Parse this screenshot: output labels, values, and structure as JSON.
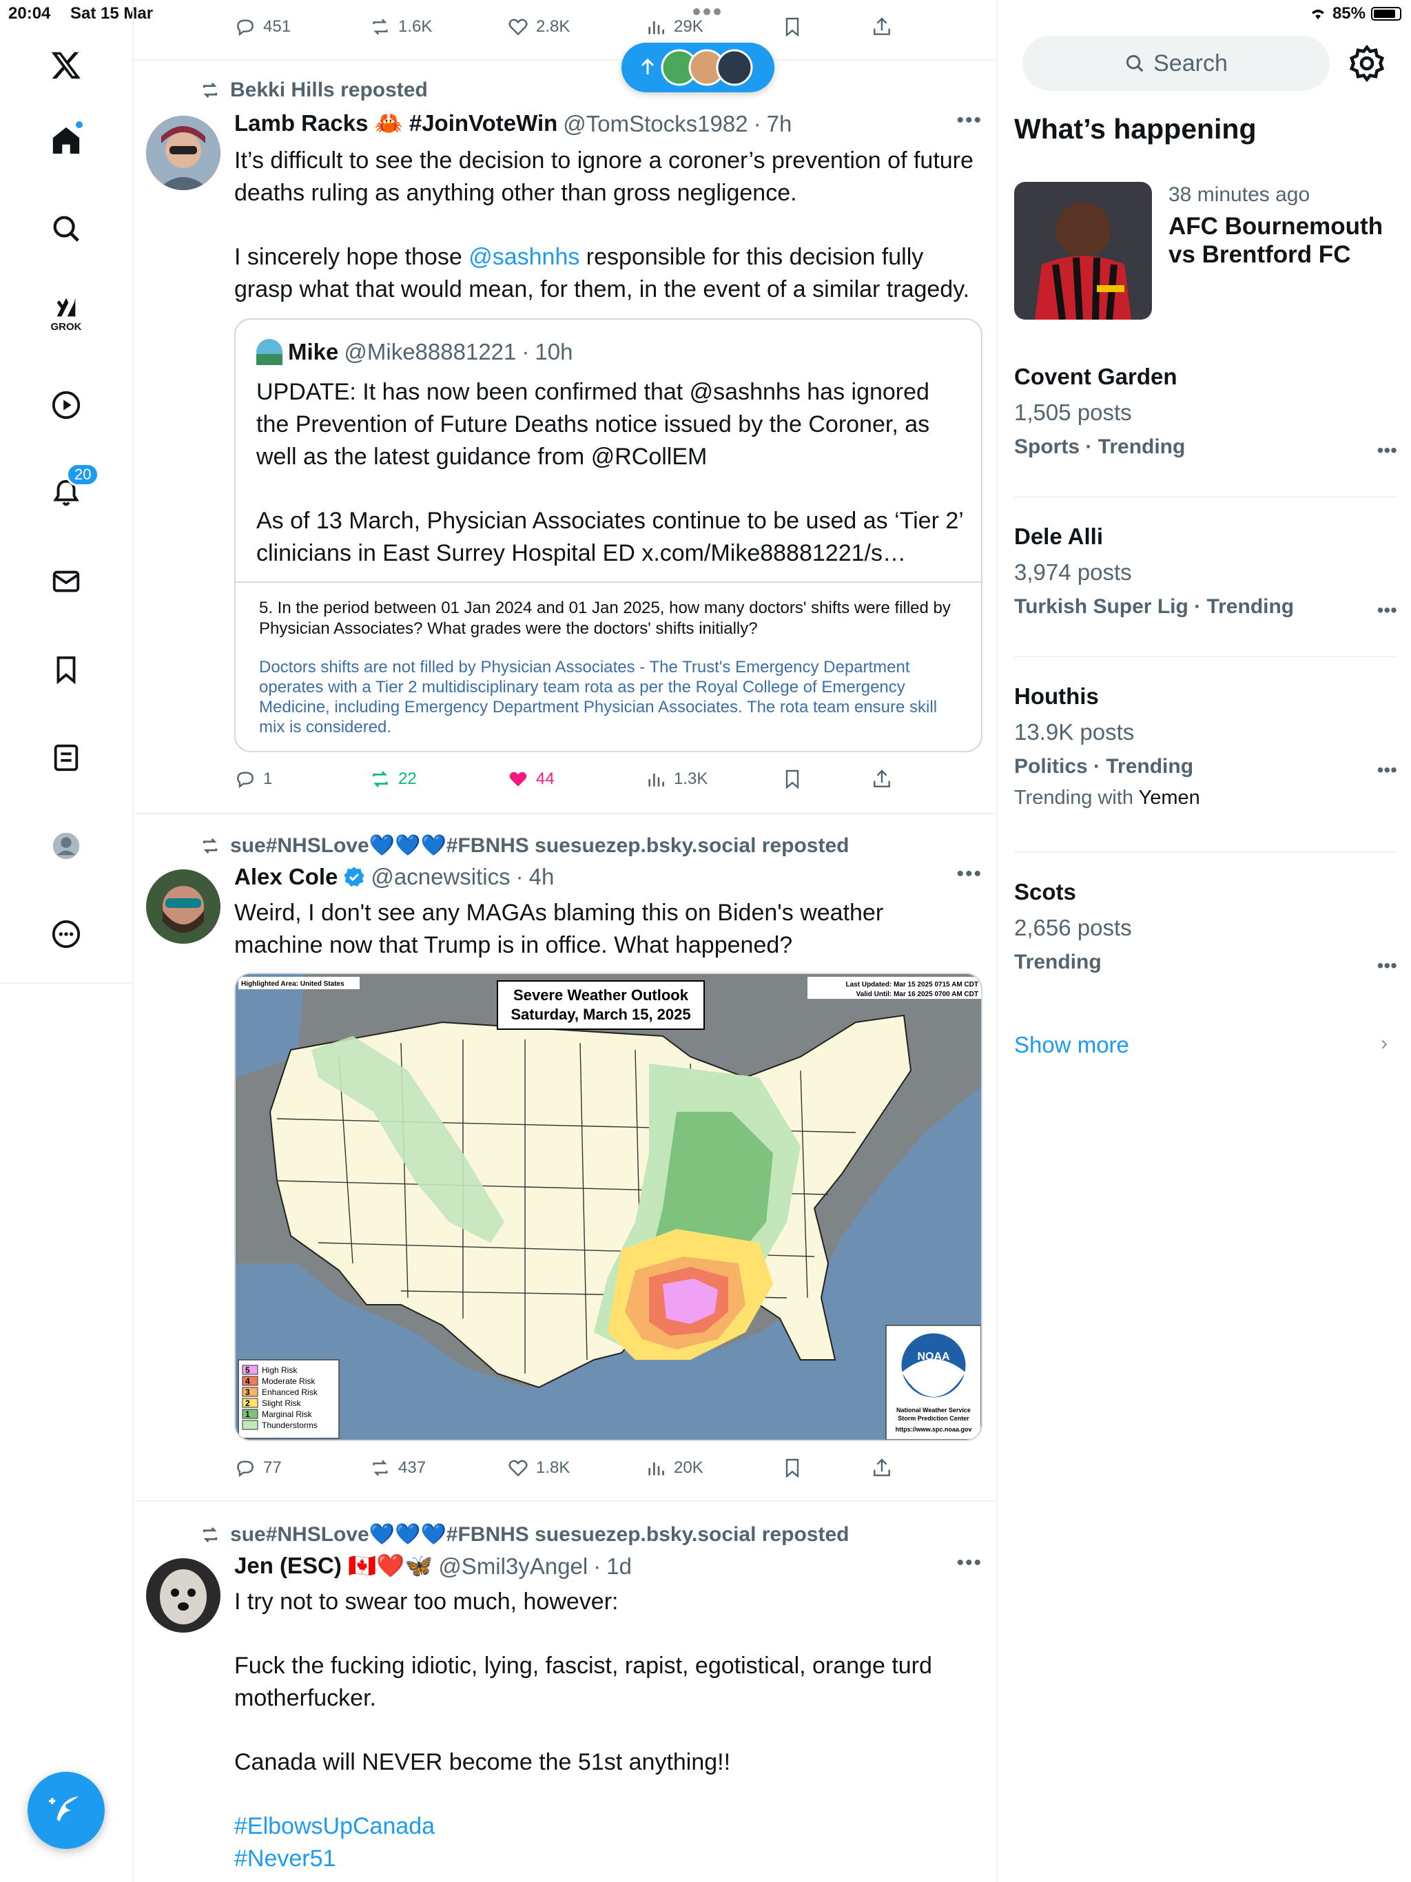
{
  "status": {
    "time": "20:04",
    "date": "Sat 15 Mar",
    "battery": "85%"
  },
  "nav": {
    "notification_count": "20",
    "grok_label": "GROK"
  },
  "top_actions": {
    "replies": "451",
    "reposts": "1.6K",
    "likes": "2.8K",
    "views": "29K"
  },
  "posts": [
    {
      "repost_by": "Bekki Hills reposted",
      "name": "Lamb Racks 🦀 #JoinVoteWin",
      "handle": "@TomStocks1982",
      "time": "7h",
      "body_1": "It’s difficult to see the decision to ignore a coroner’s prevention of future deaths ruling as anything other than gross negligence.",
      "body_2a": "I sincerely hope those ",
      "body_2_link": "@sashnhs",
      "body_2b": " responsible for this decision fully grasp what that would mean, for them, in the event of a similar tragedy.",
      "quote": {
        "name": "Mike",
        "handle": "@Mike88881221",
        "time": "10h",
        "text_1": "UPDATE: It has now been confirmed that @sashnhs has ignored the Prevention of Future Deaths notice issued by the Coroner, as well as the latest guidance from @RCollEM",
        "text_2": "As of 13 March, Physician Associates continue to be used as ‘Tier 2’ clinicians in East Surrey Hospital ED x.com/Mike88881221/s…",
        "image_question": "5. In the period between 01 Jan 2024 and 01 Jan 2025, how many doctors' shifts were filled by Physician Associates? What grades were the doctors' shifts initially?",
        "image_answer": "Doctors shifts are not filled by Physician Associates -  The Trust's Emergency Department operates with a Tier 2 multidisciplinary team rota as per the Royal College of Emergency Medicine, including Emergency Department Physician Associates. The rota team ensure skill mix is considered."
      },
      "actions": {
        "replies": "1",
        "reposts": "22",
        "likes": "44",
        "views": "1.3K"
      }
    },
    {
      "repost_by": "sue#NHSLove💙💙💙#FBNHS suesuezep.bsky.social reposted",
      "name": "Alex Cole",
      "handle": "@acnewsitics",
      "time": "4h",
      "body_1": "Weird, I don't see any MAGAs blaming this on Biden's weather machine now that Trump is in office. What happened?",
      "map": {
        "title_1": "Severe Weather Outlook",
        "title_2": "Saturday, March 15, 2025",
        "area": "Highlighted Area: United States",
        "updated": "Last Updated: Mar 15 2025 0715 AM CDT",
        "valid": "Valid Until: Mar 16 2025 0700 AM CDT",
        "legend": [
          "High Risk",
          "Moderate Risk",
          "Enhanced Risk",
          "Slight Risk",
          "Marginal Risk",
          "Thunderstorms"
        ],
        "legend_nums": [
          "5",
          "4",
          "3",
          "2",
          "1",
          ""
        ],
        "noaa": "NOAA",
        "nws_1": "National Weather Service",
        "nws_2": "Storm Prediction Center",
        "nws_url": "https://www.spc.noaa.gov"
      },
      "actions": {
        "replies": "77",
        "reposts": "437",
        "likes": "1.8K",
        "views": "20K"
      }
    },
    {
      "repost_by": "sue#NHSLove💙💙💙#FBNHS suesuezep.bsky.social reposted",
      "name": "Jen (ESC) 🇨🇦❤️🦋",
      "handle": "@Smil3yAngel",
      "time": "1d",
      "body_1": "I try not to swear too much, however:",
      "body_2": "Fuck the fucking idiotic, lying, fascist, rapist, egotistical, orange turd motherfucker.",
      "body_3": "Canada will NEVER become the 51st anything!!",
      "tag_1": "#ElbowsUpCanada",
      "tag_2": "#Never51"
    }
  ],
  "sidebar": {
    "search_placeholder": "Search",
    "heading": "What’s happening",
    "featured": {
      "time": "38 minutes ago",
      "title": "AFC Bournemouth vs Brentford FC"
    },
    "trends": [
      {
        "name": "Covent Garden",
        "count": "1,505 posts",
        "category": "Sports · Trending"
      },
      {
        "name": "Dele Alli",
        "count": "3,974 posts",
        "category": "Turkish Super Lig · Trending"
      },
      {
        "name": "Houthis",
        "count": "13.9K posts",
        "category": "Politics · Trending",
        "with_label": "Trending with ",
        "with_value": "Yemen"
      },
      {
        "name": "Scots",
        "count": "2,656 posts",
        "category": "Trending"
      }
    ],
    "show_more": "Show more"
  },
  "colors": {
    "accent": "#1d9bf0",
    "repost_active": "#00ba7c",
    "like_active": "#f91880",
    "text_secondary": "#536471"
  }
}
